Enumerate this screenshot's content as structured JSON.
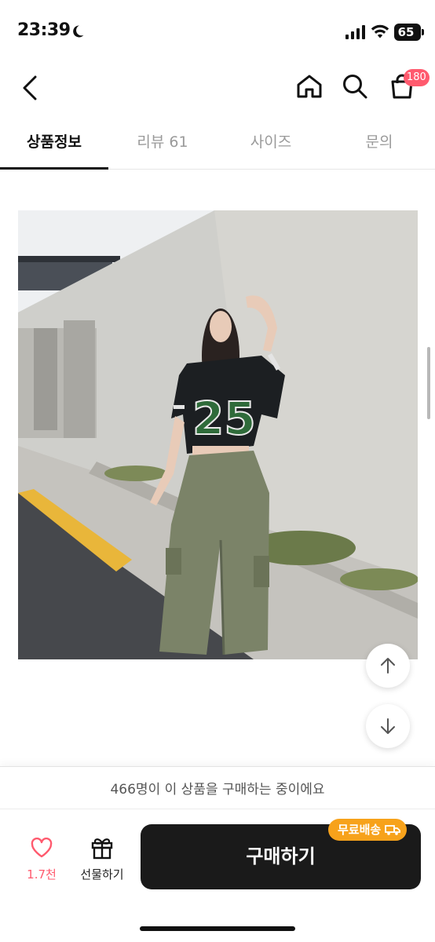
{
  "status_bar": {
    "time": "23:39",
    "battery": "65",
    "icons": [
      "moon-icon",
      "signal-icon",
      "wifi-icon",
      "battery-icon"
    ]
  },
  "nav": {
    "icons": [
      "back-arrow-icon",
      "home-icon",
      "search-icon",
      "shopping-bag-icon"
    ],
    "cart_count": "180"
  },
  "tabs": [
    {
      "label": "상품정보",
      "active": true
    },
    {
      "label": "리뷰 61",
      "active": false
    },
    {
      "label": "사이즈",
      "active": false
    },
    {
      "label": "문의",
      "active": false
    }
  ],
  "floating_buttons": {
    "icons": [
      "arrow-up-icon",
      "arrow-down-icon"
    ]
  },
  "purchase": {
    "buying_now": "466명이 이 상품을 구매하는 중이에요",
    "like_count": "1.7천",
    "gift_label": "선물하기",
    "buy_label": "구매하기",
    "free_shipping": "무료배송"
  },
  "colors": {
    "accent_pink": "#ff5a6e",
    "buy_button": "#1a1a1a",
    "shipping_badge": "#f7a21b"
  }
}
